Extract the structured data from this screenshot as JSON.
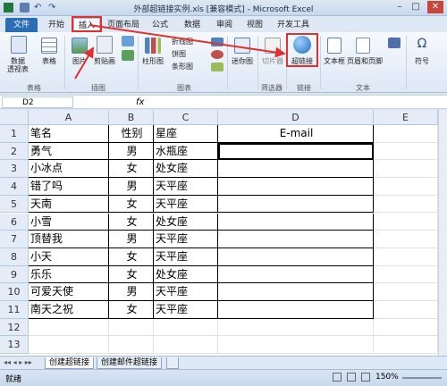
{
  "titlebar": {
    "title": "外部超链接实例.xls [兼容模式] - Microsoft Excel",
    "minimize": "–",
    "maximize": "□",
    "close": "✕"
  },
  "tabs": {
    "file": "文件",
    "home": "开始",
    "insert": "插入",
    "page_layout": "页面布局",
    "formulas": "公式",
    "data": "数据",
    "review": "审阅",
    "view": "视图",
    "developer": "开发工具"
  },
  "ribbon": {
    "pivot": "数据\n透视表",
    "table": "表格",
    "picture": "图片",
    "clipart": "剪贴画",
    "column_chart": "柱形图",
    "line_chart": "折线图",
    "pie_chart": "饼图",
    "bar_chart": "条形图",
    "sparkline": "迷你图",
    "slicer": "切片器",
    "hyperlink": "超链接",
    "textbox": "文本框",
    "header_footer": "页眉和页脚",
    "symbol": "符号",
    "group_tables": "表格",
    "group_illustrations": "插图",
    "group_charts": "图表",
    "group_filter": "筛选器",
    "group_links": "链接",
    "group_text": "文本"
  },
  "formula_bar": {
    "name_box": "D2",
    "fx": "fx",
    "value": ""
  },
  "columns": [
    "A",
    "B",
    "C",
    "D",
    "E"
  ],
  "headers": {
    "name": "笔名",
    "gender": "性别",
    "sign": "星座",
    "email": "E-mail"
  },
  "rows": [
    {
      "name": "勇气",
      "gender": "男",
      "sign": "水瓶座"
    },
    {
      "name": "小冰点",
      "gender": "女",
      "sign": "处女座"
    },
    {
      "name": "错了吗",
      "gender": "男",
      "sign": "天平座"
    },
    {
      "name": "天南",
      "gender": "女",
      "sign": "天平座"
    },
    {
      "name": "小雪",
      "gender": "女",
      "sign": "处女座"
    },
    {
      "name": "顶替我",
      "gender": "男",
      "sign": "天平座"
    },
    {
      "name": "小天",
      "gender": "女",
      "sign": "天平座"
    },
    {
      "name": "乐乐",
      "gender": "女",
      "sign": "处女座"
    },
    {
      "name": "可爱天使",
      "gender": "男",
      "sign": "天平座"
    },
    {
      "name": "南天之祝",
      "gender": "女",
      "sign": "天平座"
    }
  ],
  "row_numbers": [
    "1",
    "2",
    "3",
    "4",
    "5",
    "6",
    "7",
    "8",
    "9",
    "10",
    "11",
    "12",
    "13"
  ],
  "sheet_tabs": [
    "创建超链接",
    "创建邮件超链接"
  ],
  "status": {
    "ready": "就绪",
    "zoom": "150%"
  },
  "accent": "#2a6db5",
  "highlight": "#e03030"
}
